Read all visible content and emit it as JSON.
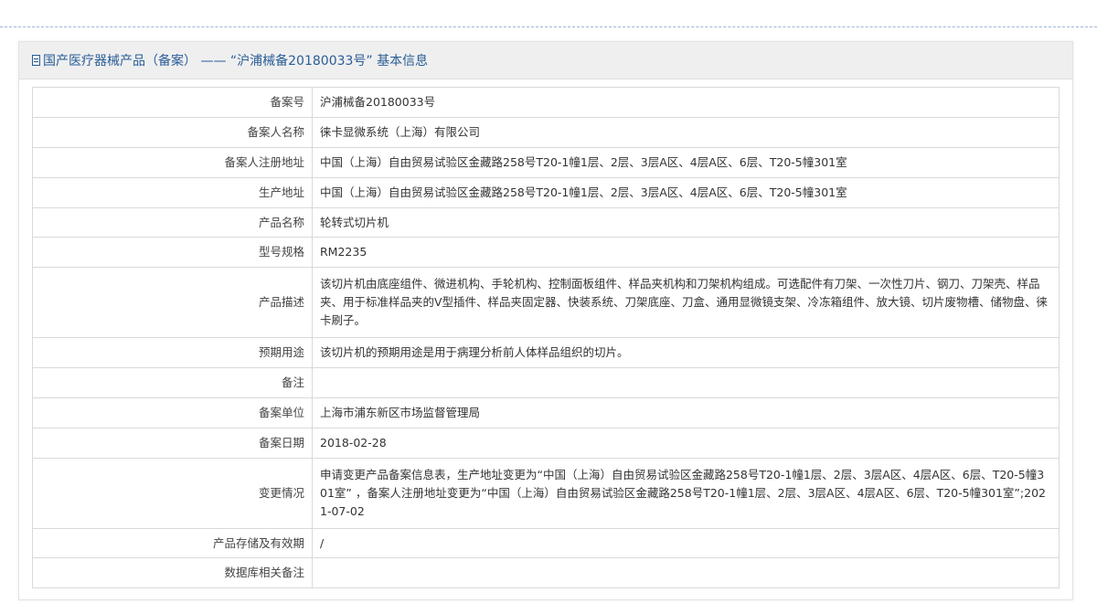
{
  "header": {
    "title": "国产医疗器械产品（备案） —— “沪浦械备20180033号” 基本信息",
    "icon": "document-icon"
  },
  "colors": {
    "header_text": "#2a5d97",
    "header_bg": "#efefef",
    "border": "#d9d9d9"
  },
  "rows": [
    {
      "key": "record-number",
      "label": "备案号",
      "value": "沪浦械备20180033号"
    },
    {
      "key": "registrant-name",
      "label": "备案人名称",
      "value": "徕卡显微系统（上海）有限公司"
    },
    {
      "key": "registrant-address",
      "label": "备案人注册地址",
      "value": "中国（上海）自由贸易试验区金藏路258号T20-1幢1层、2层、3层A区、4层A区、6层、T20-5幢301室"
    },
    {
      "key": "production-address",
      "label": "生产地址",
      "value": "中国（上海）自由贸易试验区金藏路258号T20-1幢1层、2层、3层A区、4层A区、6层、T20-5幢301室"
    },
    {
      "key": "product-name",
      "label": "产品名称",
      "value": "轮转式切片机"
    },
    {
      "key": "model-spec",
      "label": "型号规格",
      "value": "RM2235"
    },
    {
      "key": "product-description",
      "label": "产品描述",
      "value": "该切片机由底座组件、微进机构、手轮机构、控制面板组件、样品夹机构和刀架机构组成。可选配件有刀架、一次性刀片、钢刀、刀架壳、样品夹、用于标准样品夹的V型插件、样品夹固定器、快装系统、刀架底座、刀盒、通用显微镜支架、冷冻箱组件、放大镜、切片废物槽、储物盘、徕卡刷子。"
    },
    {
      "key": "intended-use",
      "label": "预期用途",
      "value": "该切片机的预期用途是用于病理分析前人体样品组织的切片。"
    },
    {
      "key": "remarks",
      "label": "备注",
      "value": ""
    },
    {
      "key": "record-unit",
      "label": "备案单位",
      "value": "上海市浦东新区市场监督管理局"
    },
    {
      "key": "record-date",
      "label": "备案日期",
      "value": "2018-02-28"
    },
    {
      "key": "change-status",
      "label": "变更情况",
      "value": "申请变更产品备案信息表，生产地址变更为“中国（上海）自由贸易试验区金藏路258号T20-1幢1层、2层、3层A区、4层A区、6层、T20-5幢301室” ，备案人注册地址变更为“中国（上海）自由贸易试验区金藏路258号T20-1幢1层、2层、3层A区、4层A区、6层、T20-5幢301室”;2021-07-02"
    },
    {
      "key": "storage-validity",
      "label": "产品存储及有效期",
      "value": "/"
    },
    {
      "key": "database-notes",
      "label": "数据库相关备注",
      "value": ""
    }
  ]
}
